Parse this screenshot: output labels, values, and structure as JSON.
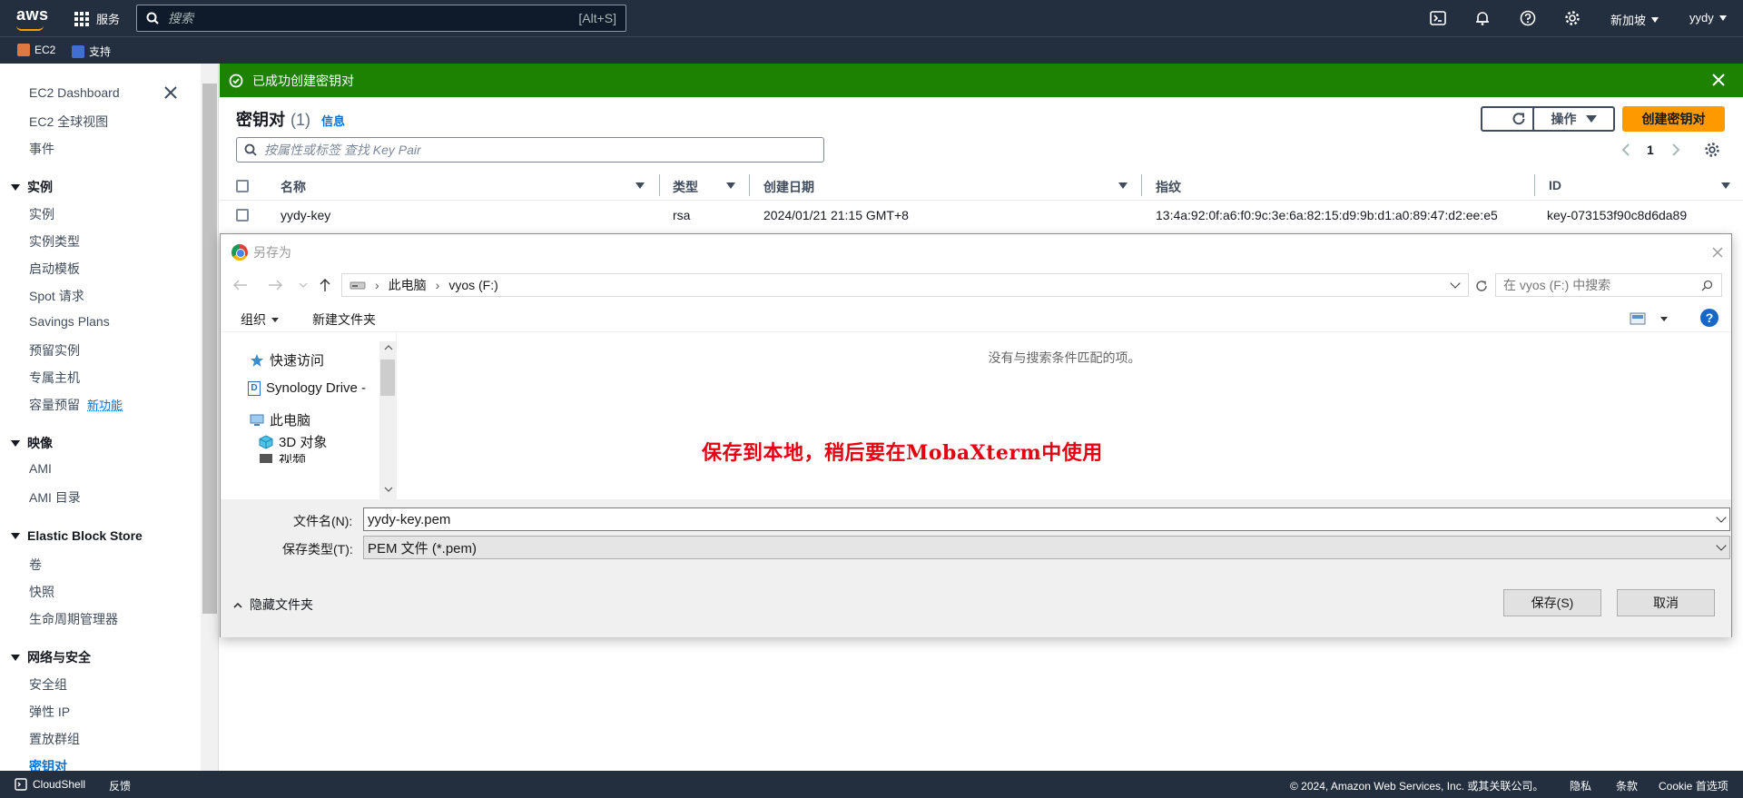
{
  "topnav": {
    "logo": "aws",
    "services": "服务",
    "search_placeholder": "搜索",
    "search_shortcut": "[Alt+S]",
    "region": "新加坡",
    "user": "yydy"
  },
  "favorites": [
    {
      "label": "EC2",
      "color": "#e07941"
    },
    {
      "label": "支持",
      "color": "#3f6fd1"
    }
  ],
  "sidebar": {
    "top_items": [
      "EC2 Dashboard",
      "EC2 全球视图",
      "事件"
    ],
    "sections": [
      {
        "title": "实例",
        "items": [
          "实例",
          "实例类型",
          "启动模板",
          "Spot 请求",
          "Savings Plans",
          "预留实例",
          "专属主机",
          "容量预留"
        ]
      },
      {
        "title": "映像",
        "items": [
          "AMI",
          "AMI 目录"
        ]
      },
      {
        "title": "Elastic Block Store",
        "items": [
          "卷",
          "快照",
          "生命周期管理器"
        ]
      },
      {
        "title": "网络与安全",
        "items": [
          "安全组",
          "弹性 IP",
          "置放群组",
          "密钥对"
        ]
      }
    ],
    "new_badge": "新功能"
  },
  "flash": {
    "message": "已成功创建密钥对",
    "color": "#1d8102"
  },
  "panel": {
    "title": "密钥对",
    "count": "(1)",
    "info": "信息",
    "actions_label": "操作",
    "create_label": "创建密钥对",
    "filter_placeholder": "按属性或标签  查找 Key Pair",
    "page": "1"
  },
  "table": {
    "headers": [
      "名称",
      "类型",
      "创建日期",
      "指纹",
      "ID"
    ],
    "rows": [
      {
        "name": "yydy-key",
        "type": "rsa",
        "created": "2024/01/21 21:15 GMT+8",
        "fingerprint": "13:4a:92:0f:a6:f0:9c:3e:6a:82:15:d9:9b:d1:a0:89:47:d2:ee:e5",
        "id": "key-073153f90c8d6da89"
      }
    ]
  },
  "dialog": {
    "title": "另存为",
    "path": [
      "此电脑",
      "vyos (F:)"
    ],
    "search_placeholder": "在 vyos (F:) 中搜索",
    "organize": "组织",
    "new_folder": "新建文件夹",
    "tree": [
      "快速访问",
      "Synology Drive -",
      "此电脑",
      "3D 对象",
      "视频"
    ],
    "empty_message": "没有与搜索条件匹配的项。",
    "filename_label": "文件名(N):",
    "filename_value": "yydy-key.pem",
    "filetype_label": "保存类型(T):",
    "filetype_value": "PEM 文件 (*.pem)",
    "hide_folders": "隐藏文件夹",
    "save_label": "保存(S)",
    "cancel_label": "取消"
  },
  "annotation": "保存到本地，稍后要在MobaXterm中使用",
  "footer": {
    "cloudshell": "CloudShell",
    "feedback": "反馈",
    "copyright": "© 2024, Amazon Web Services, Inc. 或其关联公司。",
    "privacy": "隐私",
    "terms": "条款",
    "cookies": "Cookie 首选项"
  }
}
